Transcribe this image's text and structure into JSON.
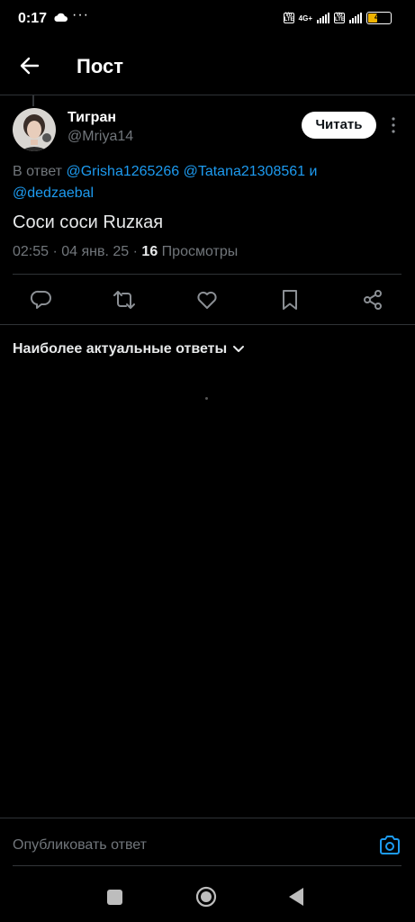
{
  "status_bar": {
    "time": "0:17",
    "dots": "···",
    "battery": "42",
    "network": "4G+"
  },
  "header": {
    "title": "Пост"
  },
  "tweet": {
    "author_name": "Тигран",
    "author_handle": "@Mriya14",
    "follow_label": "Читать",
    "reply_prefix": "В ответ",
    "mentions": [
      "@Grisha1265266",
      "@Tatana21308561",
      "и",
      "@dedzaebal"
    ],
    "text": "Соси соси Ruzкая",
    "time": "02:55",
    "date": "04 янв. 25",
    "views_count": "16",
    "views_label": "Просмотры"
  },
  "replies": {
    "sort_label": "Наиболее актуальные ответы"
  },
  "composer": {
    "placeholder": "Опубликовать ответ"
  },
  "colors": {
    "background": "#000000",
    "accent": "#1d9bf0",
    "secondary_text": "#71767b",
    "divider": "#2f3336"
  }
}
